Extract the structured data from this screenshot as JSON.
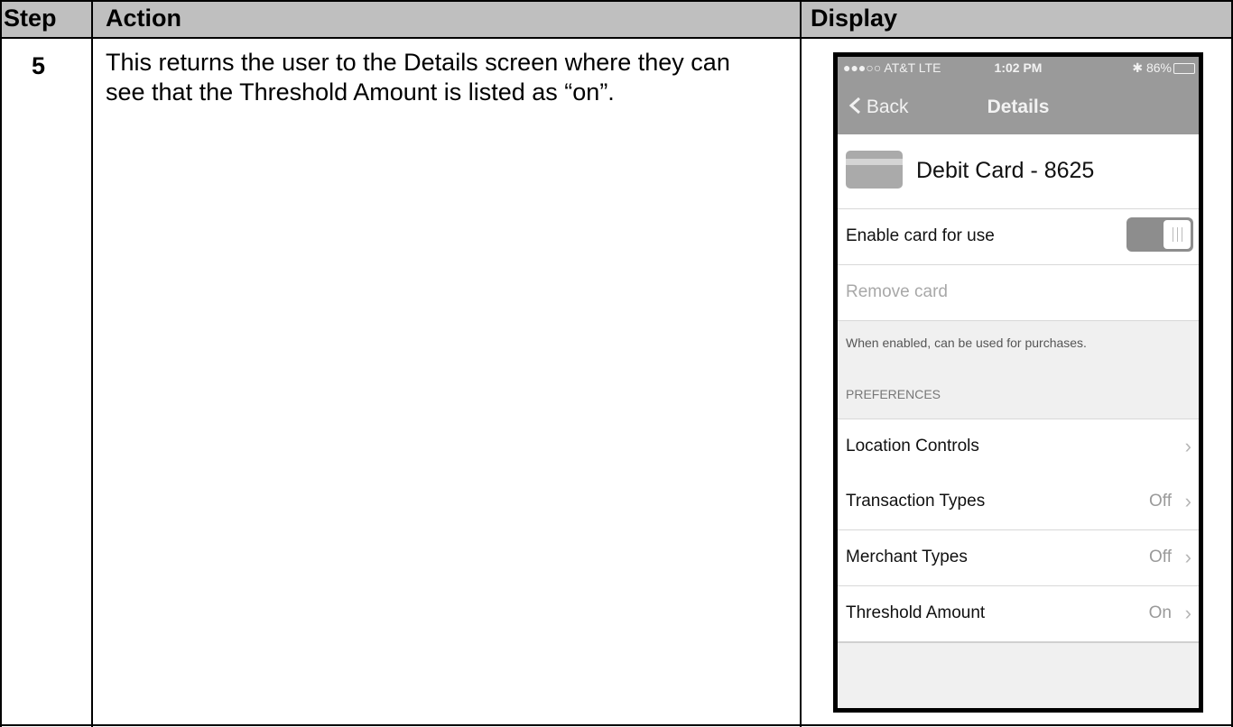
{
  "table": {
    "headers": {
      "step": "Step",
      "action": "Action",
      "display": "Display"
    },
    "row": {
      "step": "5",
      "action": "This returns the user to the Details screen where they can see that the Threshold Amount is listed as “on”."
    }
  },
  "phone": {
    "status": {
      "carrier": "●●●○○ AT&T  LTE",
      "time": "1:02 PM",
      "battery": "✱ 86%"
    },
    "nav": {
      "back": "Back",
      "title": "Details"
    },
    "card": {
      "title": "Debit Card - 8625"
    },
    "enable": {
      "label": "Enable card for use",
      "on": true
    },
    "remove": {
      "label": "Remove card"
    },
    "footnote": "When enabled, can be used for purchases.",
    "section": "PREFERENCES",
    "prefs": [
      {
        "label": "Location Controls",
        "value": ""
      },
      {
        "label": "Transaction Types",
        "value": "Off"
      },
      {
        "label": "Merchant Types",
        "value": "Off"
      },
      {
        "label": "Threshold Amount",
        "value": "On"
      }
    ]
  }
}
